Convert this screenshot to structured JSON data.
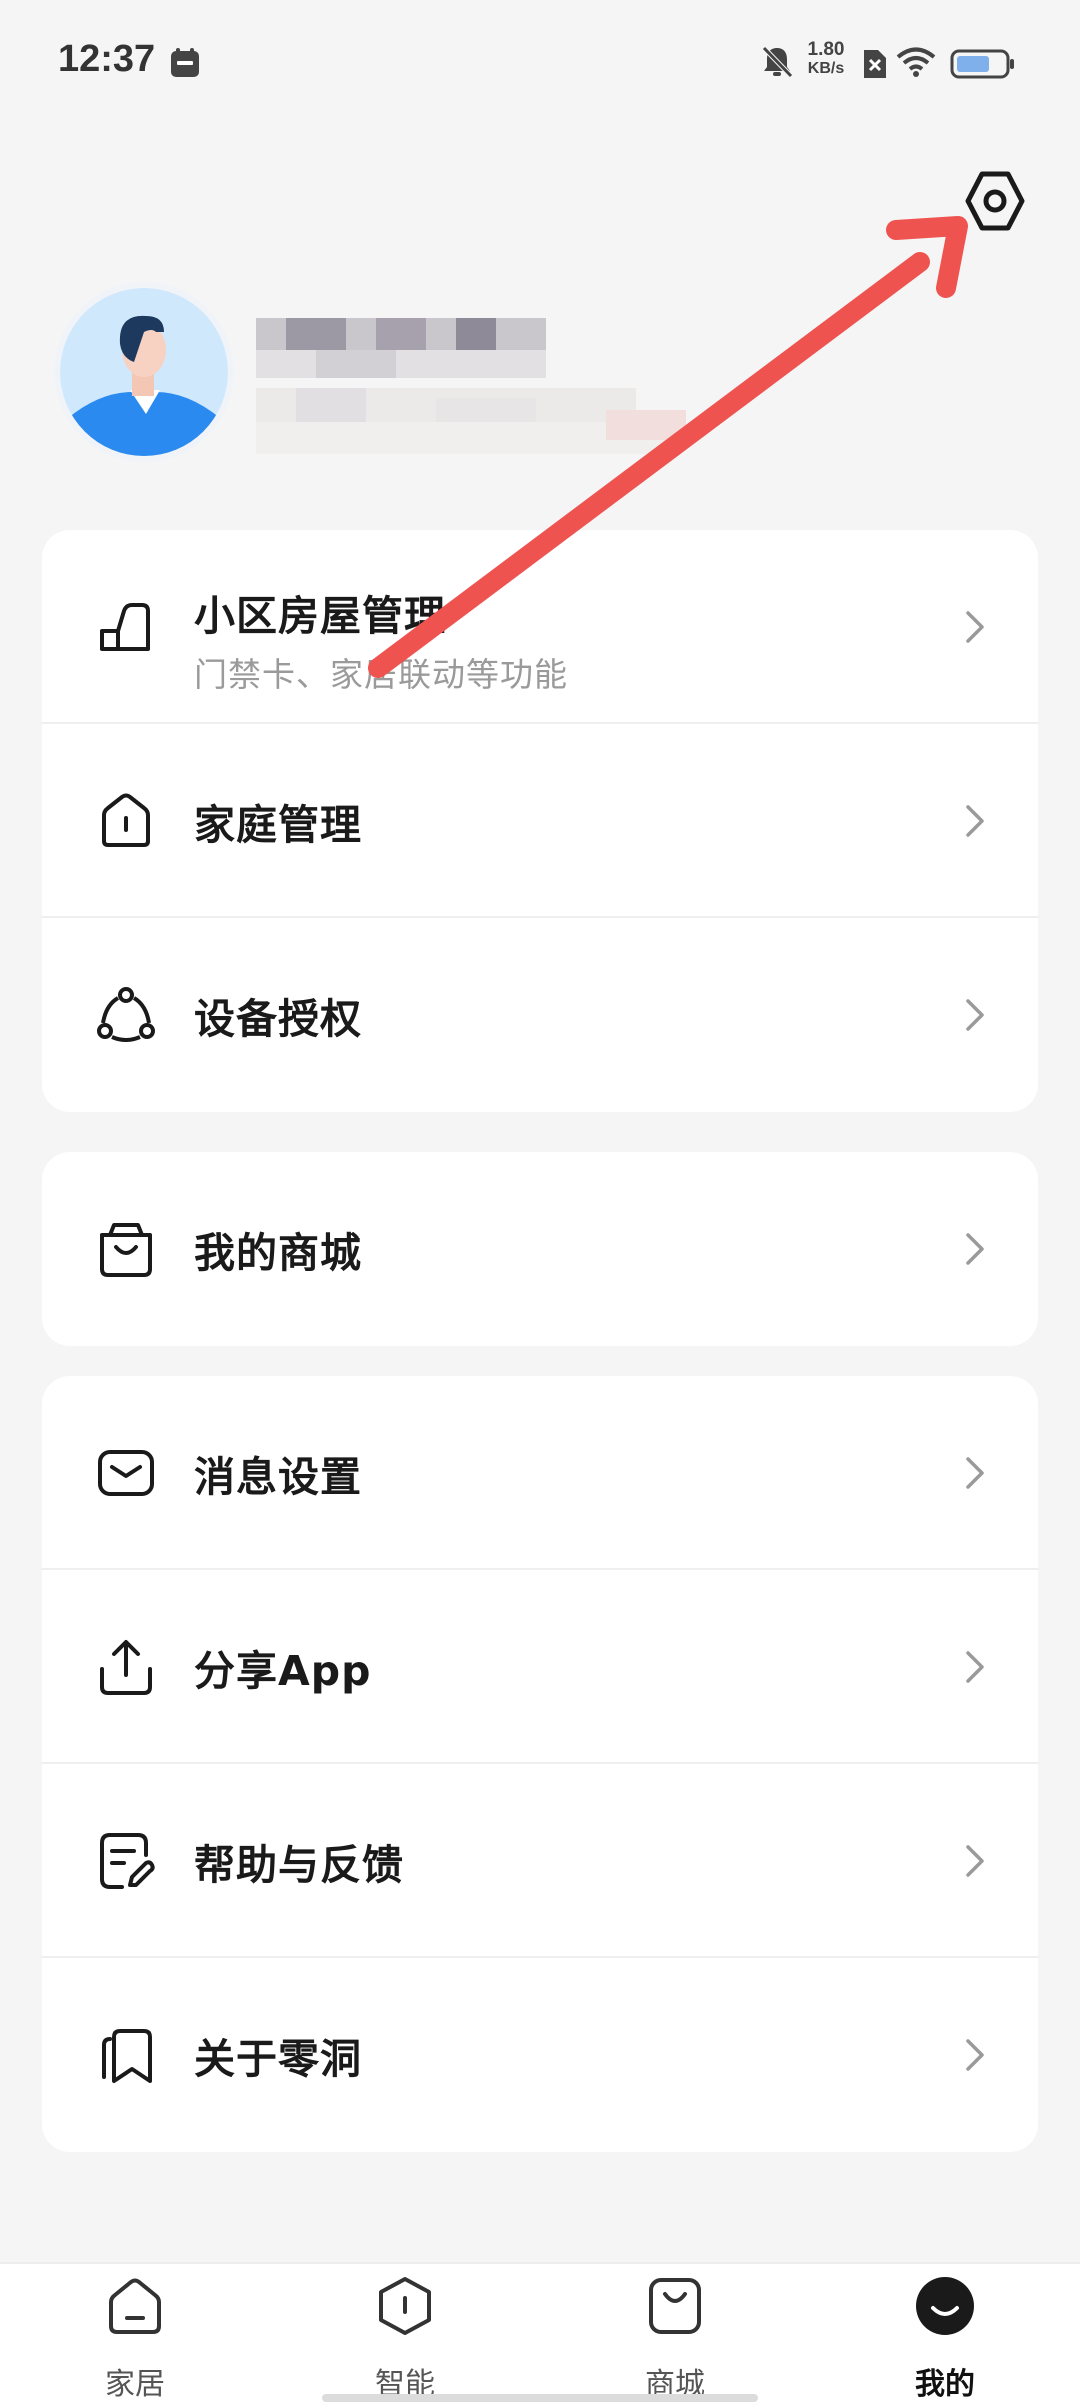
{
  "status_bar": {
    "time": "12:37",
    "net_speed_value": "1.80",
    "net_speed_unit": "KB/s",
    "icons": [
      "calendar-icon",
      "mute-bell-icon",
      "no-sim-icon",
      "wifi-icon",
      "battery-icon"
    ]
  },
  "header": {
    "settings_icon": "settings-hexagon-icon"
  },
  "profile": {
    "avatar": "user-avatar",
    "name_blurred": true
  },
  "cards": [
    {
      "rows": [
        {
          "label": "小区房屋管理",
          "sub": "门禁卡、家居联动等功能",
          "icon": "community-house-icon"
        },
        {
          "label": "家庭管理",
          "icon": "home-management-icon"
        },
        {
          "label": "设备授权",
          "icon": "device-share-icon"
        }
      ]
    },
    {
      "rows": [
        {
          "label": "我的商城",
          "icon": "shopping-bag-icon"
        }
      ]
    },
    {
      "rows": [
        {
          "label": "消息设置",
          "icon": "message-icon"
        },
        {
          "label": "分享App",
          "icon": "share-upload-icon"
        },
        {
          "label": "帮助与反馈",
          "icon": "feedback-icon"
        },
        {
          "label": "关于零洞",
          "icon": "about-bookmark-icon"
        }
      ]
    }
  ],
  "bottom_nav": {
    "items": [
      {
        "label": "家居",
        "icon": "home-tab-icon",
        "active": false
      },
      {
        "label": "智能",
        "icon": "smart-tab-icon",
        "active": false
      },
      {
        "label": "商城",
        "icon": "mall-tab-icon",
        "active": false
      },
      {
        "label": "我的",
        "icon": "me-tab-icon",
        "active": true
      }
    ]
  },
  "colors": {
    "background": "#f5f5f5",
    "card": "#ffffff",
    "annotation_arrow": "#ef5350",
    "avatar_bg": "#cfe8fb",
    "avatar_shirt": "#2a8af0"
  }
}
